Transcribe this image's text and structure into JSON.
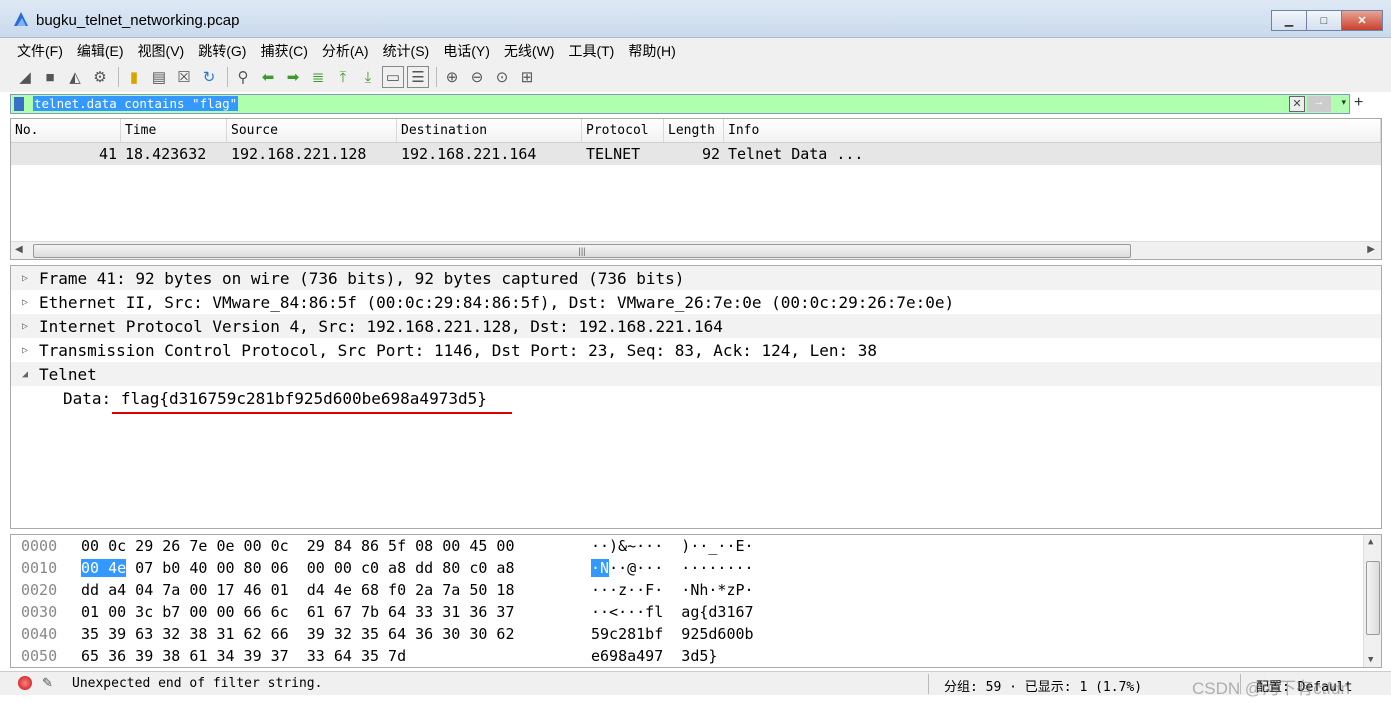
{
  "window": {
    "title": "bugku_telnet_networking.pcap"
  },
  "window_controls": {
    "minimize": "▁",
    "maximize": "□",
    "close": "✕"
  },
  "menu": [
    "文件(F)",
    "编辑(E)",
    "视图(V)",
    "跳转(G)",
    "捕获(C)",
    "分析(A)",
    "统计(S)",
    "电话(Y)",
    "无线(W)",
    "工具(T)",
    "帮助(H)"
  ],
  "toolbar": [
    "shark-start-icon",
    "stop-icon",
    "restart-icon",
    "options-icon",
    "open-icon",
    "save-icon",
    "close-file-icon",
    "reload-icon",
    "find-icon",
    "back-icon",
    "forward-icon",
    "goto-icon",
    "first-icon",
    "last-icon",
    "autoscroll-icon",
    "colorize-icon",
    "zoom-in-icon",
    "zoom-out-icon",
    "zoom-normal-icon",
    "resize-columns-icon"
  ],
  "filter": {
    "value": "telnet.data contains \"flag\"",
    "clear": "✕",
    "apply": "→",
    "dropdown": "▾",
    "add": "+"
  },
  "packet_list": {
    "columns": [
      "No.",
      "Time",
      "Source",
      "Destination",
      "Protocol",
      "Length",
      "Info"
    ],
    "rows": [
      [
        "41",
        "18.423632",
        "192.168.221.128",
        "192.168.221.164",
        "TELNET",
        "92",
        "Telnet Data ..."
      ]
    ],
    "scroll_grip": "|||",
    "scroll_left": "◀",
    "scroll_right": "▶"
  },
  "details": {
    "collapsed_arrow": "▷",
    "expanded_arrow": "◢",
    "rows": [
      "Frame 41: 92 bytes on wire (736 bits), 92 bytes captured (736 bits)",
      "Ethernet II, Src: VMware_84:86:5f (00:0c:29:84:86:5f), Dst: VMware_26:7e:0e (00:0c:29:26:7e:0e)",
      "Internet Protocol Version 4, Src: 192.168.221.128, Dst: 192.168.221.164",
      "Transmission Control Protocol, Src Port: 1146, Dst Port: 23, Seq: 83, Ack: 124, Len: 38",
      "Telnet"
    ],
    "data_label": "Data:",
    "data_value": "flag{d316759c281bf925d600be698a4973d5}"
  },
  "bytes": {
    "rows": [
      {
        "offset": "0000",
        "hex": "00 0c 29 26 7e 0e 00 0c  29 84 86 5f 08 00 45 00",
        "ascii": "··)&~···  )··_··E·"
      },
      {
        "offset": "0010",
        "hex_sel": "00 4e",
        "hex_rest": " 07 b0 40 00 80 06  00 00 c0 a8 dd 80 c0 a8",
        "ascii_sel": "·N",
        "ascii_rest": "··@···  ········"
      },
      {
        "offset": "0020",
        "hex": "dd a4 04 7a 00 17 46 01  d4 4e 68 f0 2a 7a 50 18",
        "ascii": "···z··F·  ·Nh·*zP·"
      },
      {
        "offset": "0030",
        "hex": "01 00 3c b7 00 00 66 6c  61 67 7b 64 33 31 36 37",
        "ascii": "··<···fl  ag{d3167"
      },
      {
        "offset": "0040",
        "hex": "35 39 63 32 38 31 62 66  39 32 35 64 36 30 30 62",
        "ascii": "59c281bf  925d600b"
      },
      {
        "offset": "0050",
        "hex": "65 36 39 38 61 34 39 37  33 64 35 7d",
        "ascii": "e698a497  3d5}"
      }
    ]
  },
  "status": {
    "message": "Unexpected end of filter string.",
    "packets": "分组: 59 · 已显示: 1 (1.7%)",
    "profile": "配置: Default"
  },
  "watermark": "CSDN @河下有ctfdn",
  "colors": {
    "filter_valid": "#afffaf",
    "selection": "#3399ff",
    "underline": "#e00000"
  }
}
